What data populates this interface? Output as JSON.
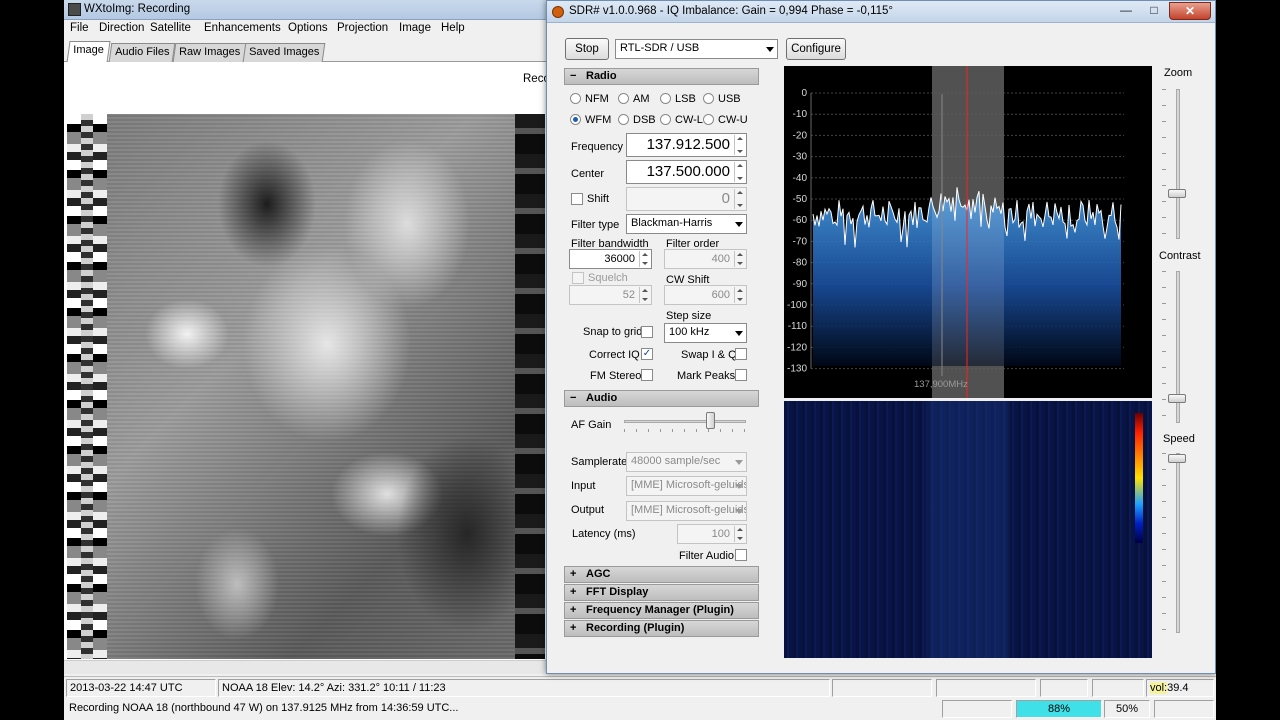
{
  "wxtoimg": {
    "title": "WXtoImg: Recording",
    "menu": [
      "File",
      "Direction",
      "Satellite",
      "Enhancements",
      "Options",
      "Projection",
      "Image",
      "Help"
    ],
    "tabs": [
      "Image",
      "Audio Files",
      "Raw Images",
      "Saved Images"
    ],
    "recording_label": "Reco",
    "status": {
      "datetime": "2013-03-22  14:47 UTC",
      "pass": "NOAA 18   Elev: 14.2°   Azi: 331.2°   10:11 / 11:23",
      "vol_label": "vol:",
      "vol_value": "39.4",
      "message": "Recording NOAA 18 (northbound 47 W) on 137.9125 MHz from 14:36:59 UTC...",
      "progress": "88%",
      "zoom": "50%"
    }
  },
  "sdr": {
    "title": "SDR# v1.0.0.968 - IQ Imbalance: Gain = 0,994 Phase = -0,115°",
    "stop_label": "Stop",
    "device": "RTL-SDR / USB",
    "configure_label": "Configure",
    "radio": {
      "header": "Radio",
      "modes": [
        "NFM",
        "AM",
        "LSB",
        "USB",
        "WFM",
        "DSB",
        "CW-L",
        "CW-U"
      ],
      "selected_mode": "WFM",
      "frequency_label": "Frequency",
      "frequency": "137.912.500",
      "center_label": "Center",
      "center": "137.500.000",
      "shift_label": "Shift",
      "shift": "0",
      "filter_type_label": "Filter type",
      "filter_type": "Blackman-Harris",
      "filter_bandwidth_label": "Filter bandwidth",
      "filter_bandwidth": "36000",
      "filter_order_label": "Filter order",
      "filter_order": "400",
      "squelch_label": "Squelch",
      "squelch": "52",
      "cw_shift_label": "CW Shift",
      "cw_shift": "600",
      "step_size_label": "Step size",
      "step_size": "100 kHz",
      "snap_to_grid_label": "Snap to grid",
      "correct_iq_label": "Correct IQ",
      "swap_iq_label": "Swap I & Q",
      "fm_stereo_label": "FM Stereo",
      "mark_peaks_label": "Mark Peaks"
    },
    "audio": {
      "header": "Audio",
      "af_gain_label": "AF Gain",
      "samplerate_label": "Samplerate",
      "samplerate": "48000 sample/sec",
      "input_label": "Input",
      "input": "[MME] Microsoft-geluids",
      "output_label": "Output",
      "output": "[MME] Microsoft-geluids",
      "latency_label": "Latency (ms)",
      "latency": "100",
      "filter_audio_label": "Filter Audio"
    },
    "collapsed_sections": [
      "AGC",
      "FFT Display",
      "Frequency Manager (Plugin)",
      "Recording (Plugin)"
    ],
    "spectrum": {
      "db_labels": [
        "0",
        "-10",
        "-20",
        "-30",
        "-40",
        "-50",
        "-60",
        "-70",
        "-80",
        "-90",
        "-100",
        "-110",
        "-120",
        "-130"
      ],
      "freq_label": "137,900MHz"
    },
    "zoom_label": "Zoom",
    "contrast_label": "Contrast",
    "speed_label": "Speed"
  }
}
